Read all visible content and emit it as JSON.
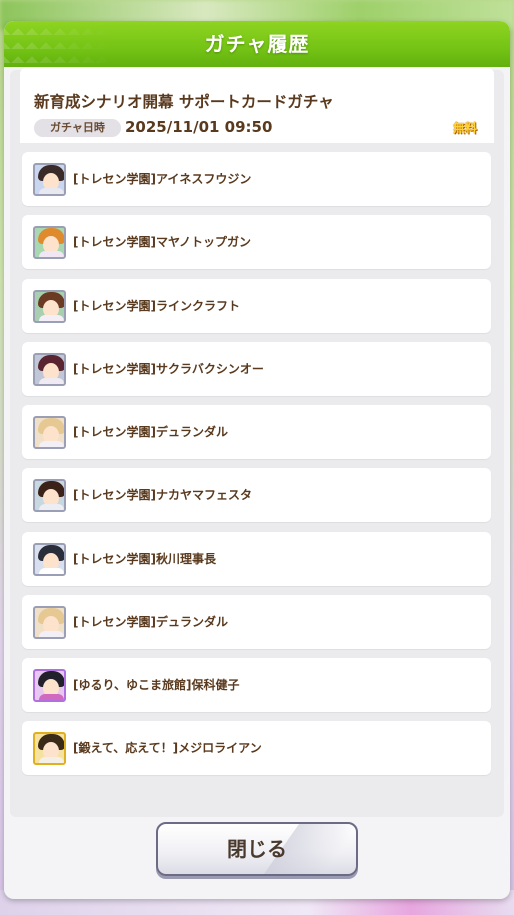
{
  "dialog": {
    "title": "ガチャ履歴",
    "gacha_name": "新育成シナリオ開幕 サポートカードガチャ",
    "date_label": "ガチャ日時",
    "date_value": "2025/11/01 09:50",
    "price_badge": "無料",
    "close_label": "閉じる"
  },
  "results": [
    {
      "label": "[トレセン学園]アイネスフウジン",
      "icon": "character-thumbnail-icon",
      "hair": "#3a2a28",
      "body": "#e8e8f0",
      "bg": "#c9d6f0",
      "frame": "#9a9fb5"
    },
    {
      "label": "[トレセン学園]マヤノトップガン",
      "icon": "character-thumbnail-icon",
      "hair": "#e08a2e",
      "body": "#f0e6f4",
      "bg": "#a8d8b0",
      "frame": "#9a9fb5"
    },
    {
      "label": "[トレセン学園]ラインクラフト",
      "icon": "character-thumbnail-icon",
      "hair": "#6a3a22",
      "body": "#f4eef6",
      "bg": "#a8d0b0",
      "frame": "#9a9fb5"
    },
    {
      "label": "[トレセン学園]サクラバクシンオー",
      "icon": "character-thumbnail-icon",
      "hair": "#5a2430",
      "body": "#f0eaf2",
      "bg": "#c0c8d8",
      "frame": "#9a9fb5"
    },
    {
      "label": "[トレセン学園]デュランダル",
      "icon": "character-thumbnail-icon",
      "hair": "#e6c893",
      "body": "#f2f0f6",
      "bg": "#f0e0c8",
      "frame": "#9a9fb5"
    },
    {
      "label": "[トレセン学園]ナカヤマフェスタ",
      "icon": "character-thumbnail-icon",
      "hair": "#3a2218",
      "body": "#eceef4",
      "bg": "#c8d8e0",
      "frame": "#9a9fb5"
    },
    {
      "label": "[トレセン学園]秋川理事長",
      "icon": "character-thumbnail-icon",
      "hair": "#2a2e3a",
      "body": "#ffffff",
      "bg": "#d8e0f0",
      "frame": "#9a9fb5"
    },
    {
      "label": "[トレセン学園]デュランダル",
      "icon": "character-thumbnail-icon",
      "hair": "#e6c893",
      "body": "#f2f0f6",
      "bg": "#f0e0c8",
      "frame": "#9a9fb5"
    },
    {
      "label": "[ゆるり、ゆこま旅館]保科健子",
      "icon": "character-thumbnail-icon",
      "hair": "#22202a",
      "body": "#d06ac0",
      "bg": "#e8c8f0",
      "frame": "#b070e0"
    },
    {
      "label": "[鍛えて、応えて！]メジロライアン",
      "icon": "character-thumbnail-icon",
      "hair": "#3a2a18",
      "body": "#f4f0e8",
      "bg": "#f6e2a0",
      "frame": "#e0b020"
    }
  ]
}
